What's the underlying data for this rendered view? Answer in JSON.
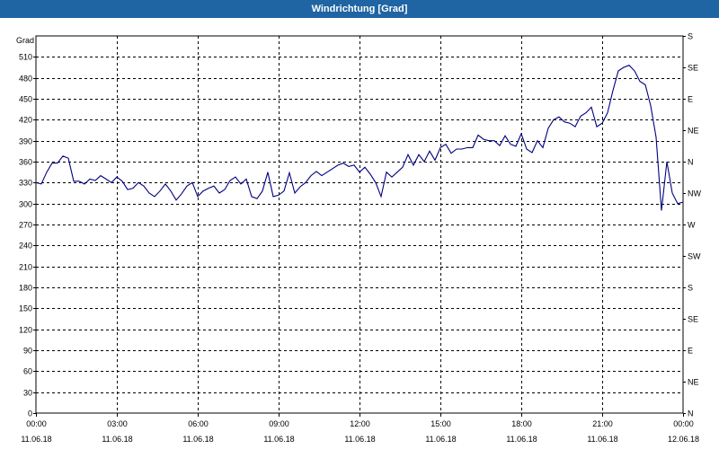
{
  "window": {
    "title": "Windrichtung [Grad]"
  },
  "chart_data": {
    "type": "line",
    "title": "Windrichtung [Grad]",
    "ylabel": "Grad",
    "ylim": [
      0,
      540
    ],
    "yticks": [
      0,
      30,
      60,
      90,
      120,
      150,
      180,
      210,
      240,
      270,
      300,
      330,
      360,
      390,
      420,
      450,
      480,
      510
    ],
    "right_axis_labels": [
      "N",
      "NE",
      "E",
      "SE",
      "S",
      "SW",
      "W",
      "NW",
      "N",
      "NE",
      "E",
      "SE",
      "S"
    ],
    "right_axis_values": [
      0,
      45,
      90,
      135,
      180,
      225,
      270,
      315,
      360,
      405,
      450,
      495,
      540
    ],
    "xlim": [
      0,
      24
    ],
    "x_tick_hours": [
      0,
      3,
      6,
      9,
      12,
      15,
      18,
      21,
      24
    ],
    "x_tick_labels": [
      {
        "time": "00:00",
        "date": "11.06.18"
      },
      {
        "time": "03:00",
        "date": "11.06.18"
      },
      {
        "time": "06:00",
        "date": "11.06.18"
      },
      {
        "time": "09:00",
        "date": "11.06.18"
      },
      {
        "time": "12:00",
        "date": "11.06.18"
      },
      {
        "time": "15:00",
        "date": "11.06.18"
      },
      {
        "time": "18:00",
        "date": "11.06.18"
      },
      {
        "time": "21:00",
        "date": "11.06.18"
      },
      {
        "time": "00:00",
        "date": "12.06.18"
      }
    ],
    "grid": true,
    "line_color": "#000080",
    "series": [
      {
        "x_hours": [
          0,
          0.2,
          0.4,
          0.6,
          0.8,
          1,
          1.2,
          1.4,
          1.6,
          1.8,
          2,
          2.2,
          2.4,
          2.6,
          2.8,
          3,
          3.2,
          3.4,
          3.6,
          3.8,
          4,
          4.2,
          4.4,
          4.6,
          4.8,
          5,
          5.2,
          5.4,
          5.6,
          5.8,
          6,
          6.2,
          6.4,
          6.6,
          6.8,
          7,
          7.2,
          7.4,
          7.6,
          7.8,
          8,
          8.2,
          8.4,
          8.6,
          8.8,
          9,
          9.2,
          9.4,
          9.6,
          9.8,
          10,
          10.2,
          10.4,
          10.6,
          10.8,
          11,
          11.2,
          11.4,
          11.6,
          11.8,
          12,
          12.2,
          12.4,
          12.6,
          12.8,
          13,
          13.2,
          13.4,
          13.6,
          13.8,
          14,
          14.2,
          14.4,
          14.6,
          14.8,
          15,
          15.2,
          15.4,
          15.6,
          15.8,
          16,
          16.2,
          16.4,
          16.6,
          16.8,
          17,
          17.2,
          17.4,
          17.6,
          17.8,
          18,
          18.2,
          18.4,
          18.6,
          18.8,
          19,
          19.2,
          19.4,
          19.6,
          19.8,
          20,
          20.2,
          20.4,
          20.6,
          20.8,
          21,
          21.2,
          21.4,
          21.6,
          21.8,
          22,
          22.2,
          22.4,
          22.6,
          22.8,
          23,
          23.2,
          23.4,
          23.6,
          23.8,
          24
        ],
        "values": [
          330,
          328,
          345,
          358,
          358,
          368,
          365,
          332,
          332,
          328,
          335,
          333,
          340,
          335,
          330,
          338,
          332,
          320,
          322,
          330,
          325,
          315,
          310,
          318,
          328,
          318,
          305,
          314,
          325,
          330,
          310,
          318,
          322,
          325,
          315,
          320,
          333,
          338,
          328,
          335,
          310,
          307,
          318,
          345,
          310,
          312,
          318,
          344,
          315,
          324,
          330,
          340,
          346,
          340,
          345,
          350,
          355,
          358,
          353,
          355,
          345,
          352,
          342,
          330,
          310,
          345,
          338,
          345,
          352,
          370,
          355,
          370,
          360,
          375,
          362,
          380,
          385,
          372,
          378,
          378,
          380,
          380,
          398,
          392,
          390,
          390,
          383,
          397,
          385,
          382,
          400,
          378,
          373,
          390,
          380,
          408,
          420,
          424,
          417,
          415,
          410,
          425,
          430,
          438,
          410,
          415,
          430,
          462,
          490,
          495,
          498,
          490,
          475,
          470,
          440,
          395,
          290,
          360,
          315,
          300,
          302,
          300,
          330
        ]
      }
    ]
  }
}
